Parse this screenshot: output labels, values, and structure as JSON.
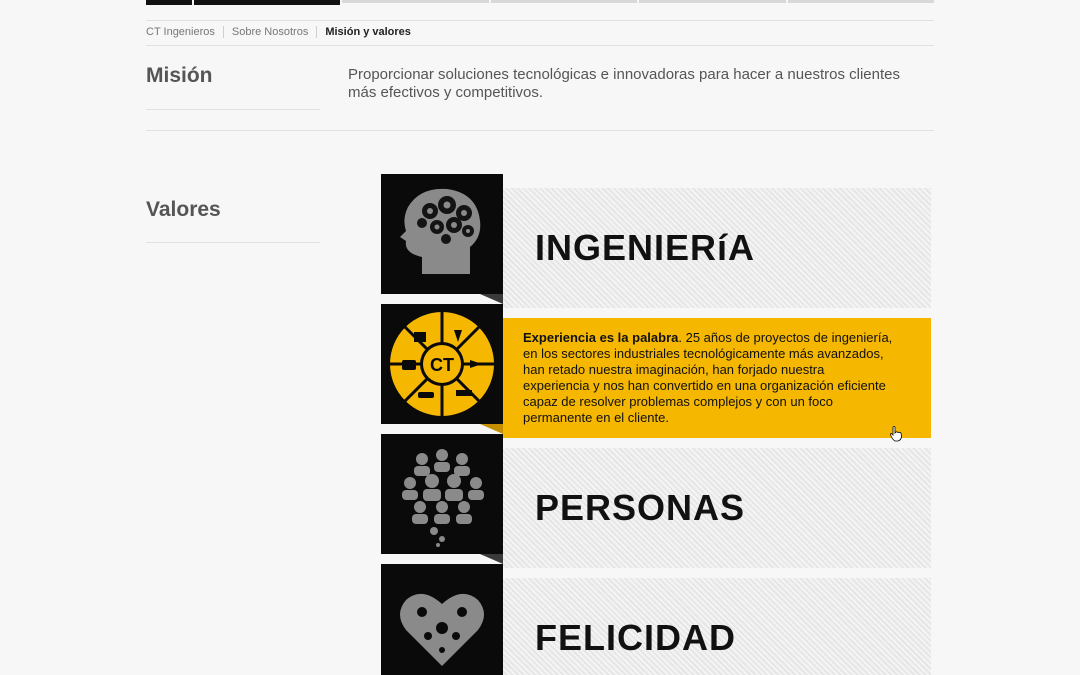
{
  "breadcrumb": {
    "items": [
      "CT Ingenieros",
      "Sobre Nosotros"
    ],
    "current": "Misión y valores"
  },
  "mision": {
    "title": "Misión",
    "text": "Proporcionar soluciones tecnológicas e innovadoras para hacer a nuestros clientes más efectivos y competitivos."
  },
  "valores": {
    "title": "Valores",
    "cards": [
      {
        "label": "INGENIERíA",
        "icon": "brain-gears-icon"
      },
      {
        "strong": "Experiencia es la palabra",
        "text": ". 25 años de proyectos de ingeniería, en los sectores industriales tecnológicamente más avanzados, han retado nuestra imaginación, han forjado nuestra experiencia y nos han convertido en una organización eficiente capaz de resolver problemas complejos y con un foco permanente en el cliente.",
        "icon": "ct-sectors-wheel-icon",
        "center": "CT"
      },
      {
        "label": "PERSONAS",
        "icon": "people-speech-bubble-icon"
      },
      {
        "label": "FELICIDAD",
        "icon": "gears-heart-icon"
      }
    ]
  },
  "colors": {
    "accent": "#f5b700",
    "dark": "#0a0a0a",
    "panel": "#e6e6e6"
  }
}
